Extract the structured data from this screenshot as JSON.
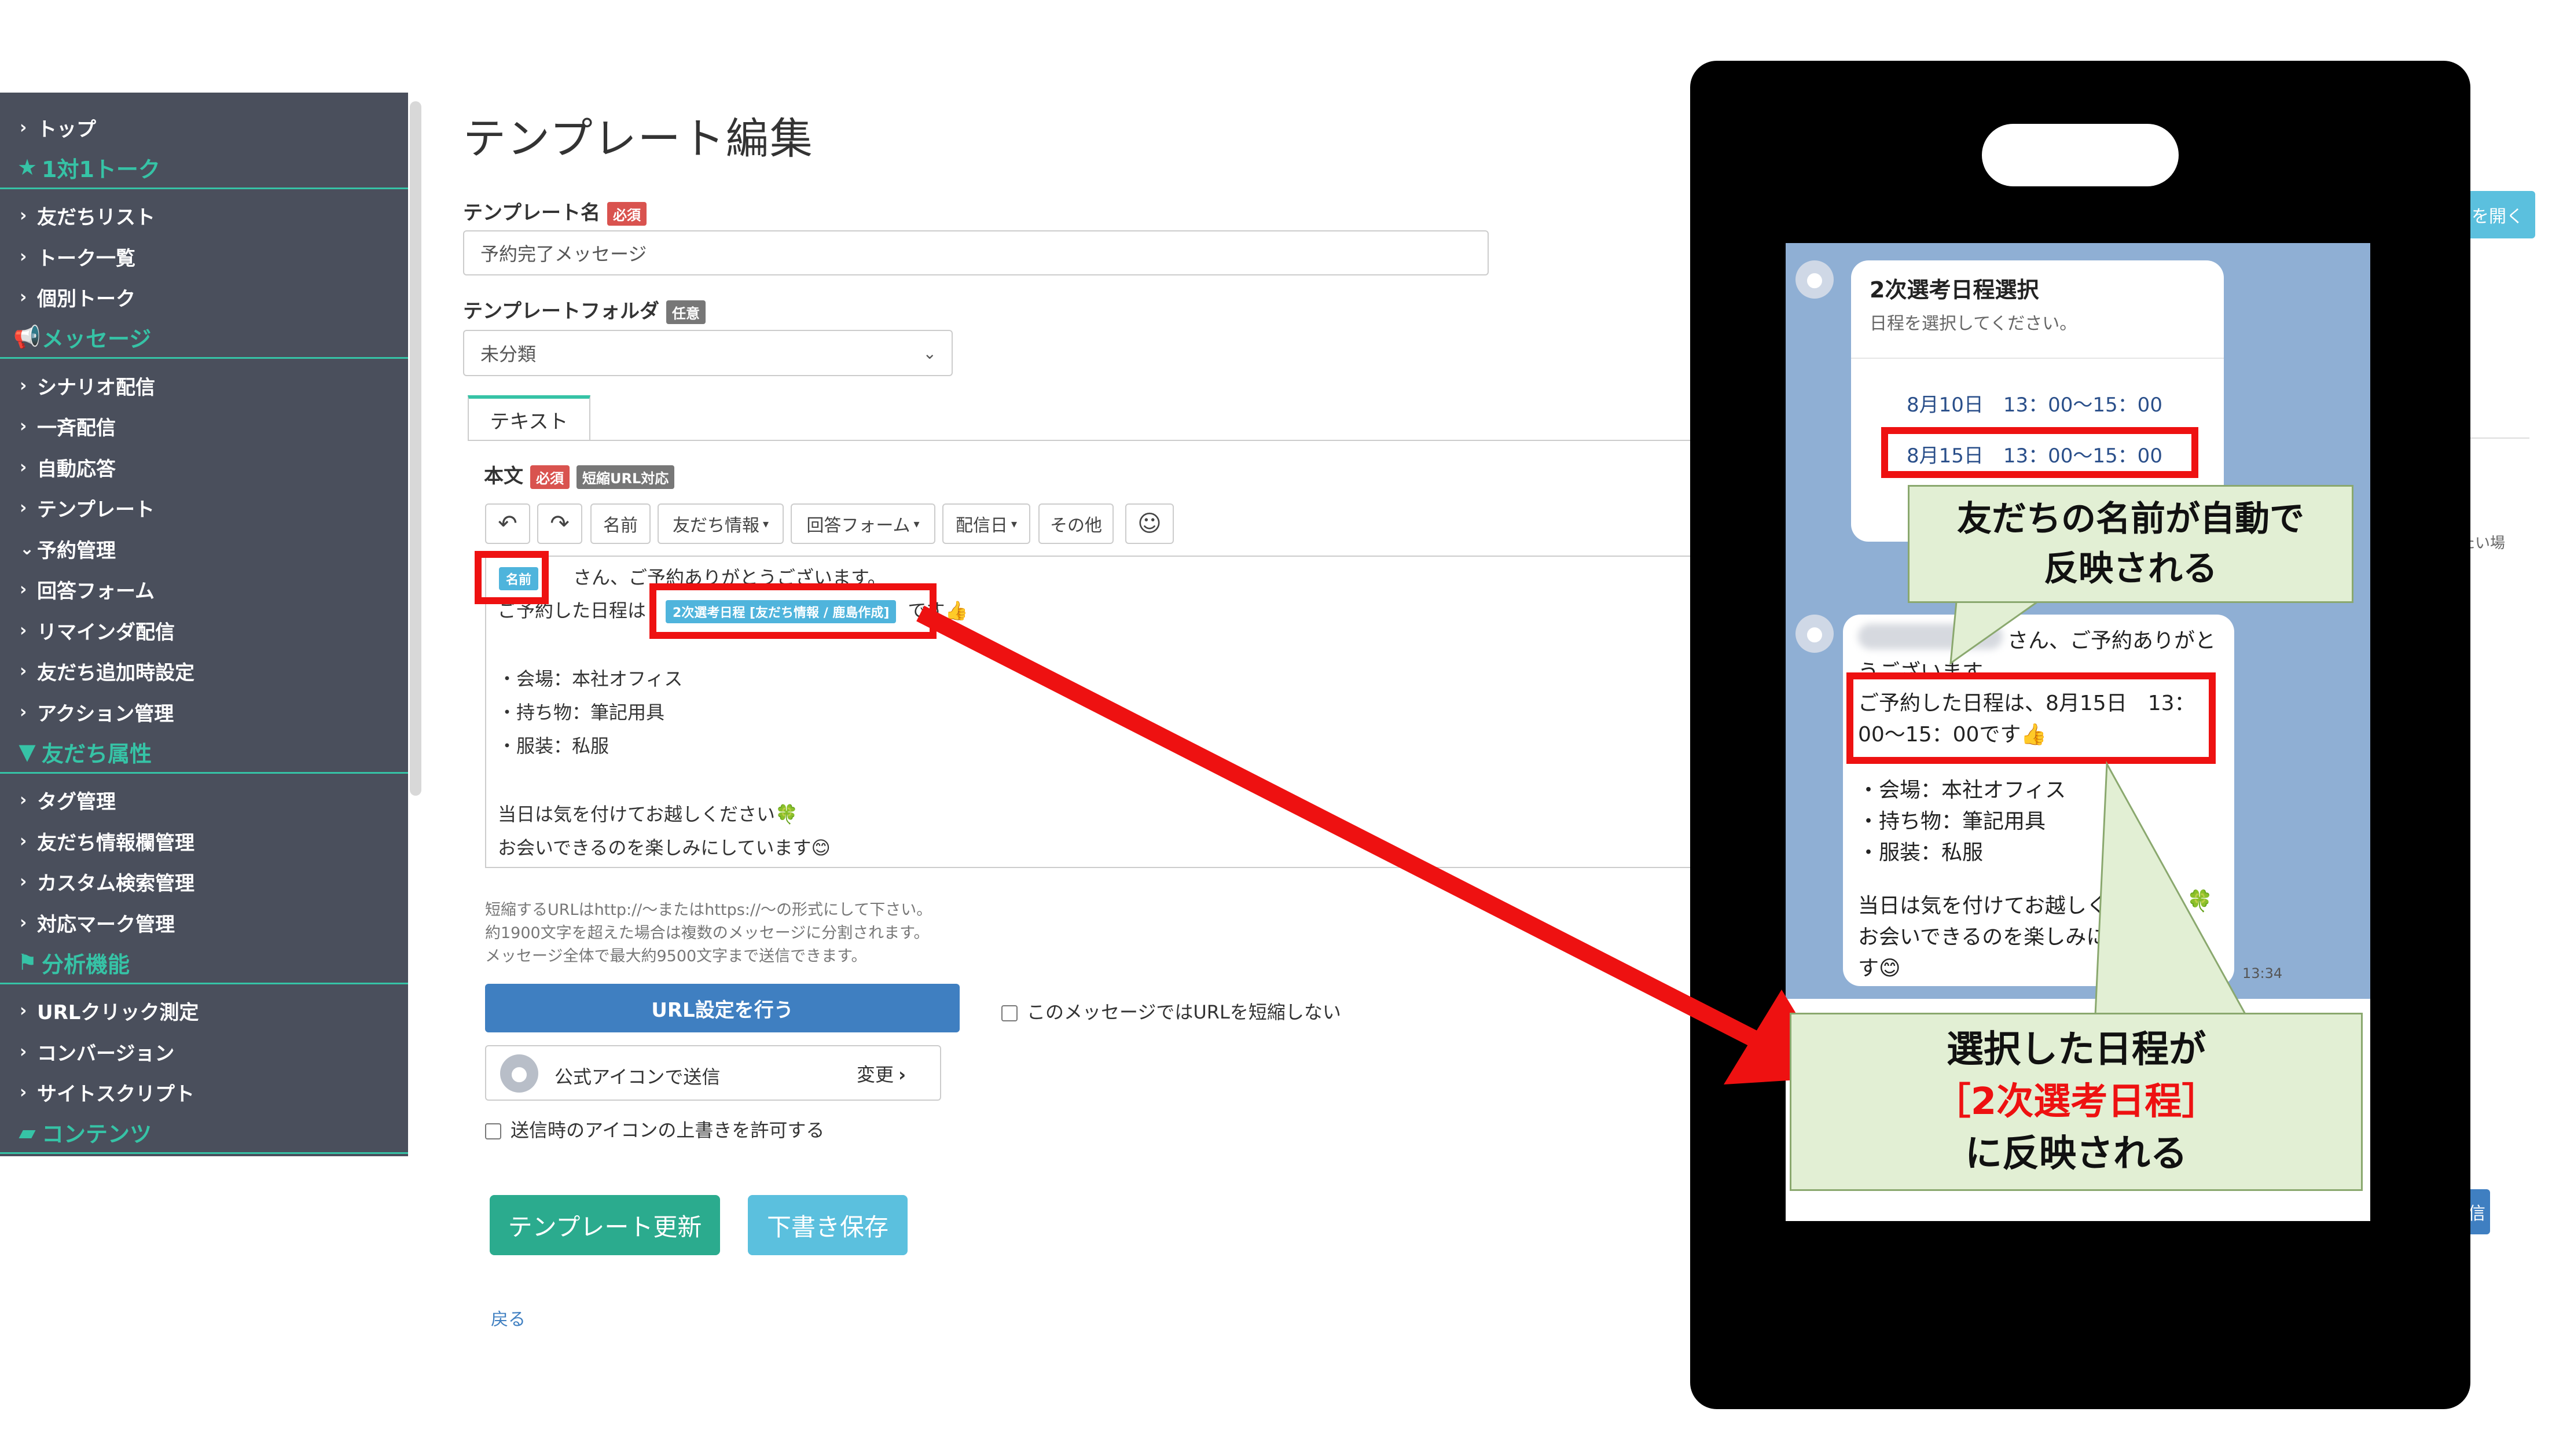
{
  "sidebar": {
    "items": [
      {
        "type": "item",
        "label": "トップ"
      },
      {
        "type": "head",
        "icon": "star-icon",
        "glyph": "★",
        "label": "1対1トーク"
      },
      {
        "type": "item",
        "label": "友だちリスト"
      },
      {
        "type": "item",
        "label": "トーク一覧"
      },
      {
        "type": "item",
        "label": "個別トーク"
      },
      {
        "type": "head",
        "icon": "megaphone-icon",
        "glyph": "📢",
        "label": "メッセージ"
      },
      {
        "type": "item",
        "label": "シナリオ配信"
      },
      {
        "type": "item",
        "label": "一斉配信"
      },
      {
        "type": "item",
        "label": "自動応答"
      },
      {
        "type": "item",
        "label": "テンプレート"
      },
      {
        "type": "item",
        "label": "予約管理",
        "open": true
      },
      {
        "type": "item",
        "label": "回答フォーム"
      },
      {
        "type": "item",
        "label": "リマインダ配信"
      },
      {
        "type": "item",
        "label": "友だち追加時設定"
      },
      {
        "type": "item",
        "label": "アクション管理"
      },
      {
        "type": "head",
        "icon": "filter-icon",
        "glyph": "▼",
        "label": "友だち属性"
      },
      {
        "type": "item",
        "label": "タグ管理"
      },
      {
        "type": "item",
        "label": "友だち情報欄管理"
      },
      {
        "type": "item",
        "label": "カスタム検索管理"
      },
      {
        "type": "item",
        "label": "対応マーク管理"
      },
      {
        "type": "head",
        "icon": "flag-icon",
        "glyph": "⚑",
        "label": "分析機能"
      },
      {
        "type": "item",
        "label": "URLクリック測定"
      },
      {
        "type": "item",
        "label": "コンバージョン"
      },
      {
        "type": "item",
        "label": "サイトスクリプト"
      },
      {
        "type": "head",
        "icon": "folder-icon",
        "glyph": "▰",
        "label": "コンテンツ"
      }
    ]
  },
  "main": {
    "title": "テンプレート編集",
    "name_label": "テンプレート名",
    "required_badge": "必須",
    "optional_badge": "任意",
    "name_value": "予約完了メッセージ",
    "folder_label": "テンプレートフォルダ",
    "folder_value": "未分類",
    "tab_text": "テキスト",
    "body_label": "本文",
    "short_url_badge": "短縮URL対応",
    "toolbar": {
      "undo": "↶",
      "redo": "↷",
      "name": "名前",
      "friend_info": "友だち情報",
      "answer_form": "回答フォーム",
      "delivery_date": "配信日",
      "other": "その他",
      "emoji": "☺"
    },
    "editor": {
      "name_chip": "名前",
      "line1_rest": "さん、ご予約ありがとうございます。",
      "line2_pre": "ご予約した日程は",
      "schedule_chip": "2次選考日程 [友だち情報 / 鹿島作成]",
      "line2_post": "です👍",
      "line3": "・会場：本社オフィス",
      "line4": "・持ち物：筆記用具",
      "line5": "・服装：私服",
      "line6": "当日は気を付けてお越しください🍀",
      "line7": "お会いできるのを楽しみにしています😊"
    },
    "notes": [
      "短縮するURLはhttp://〜またはhttps://〜の形式にして下さい。",
      "約1900文字を超えた場合は複数のメッセージに分割されます。",
      "メッセージ全体で最大約9500文字まで送信できます。"
    ],
    "url_button": "URL設定を行う",
    "no_shorten_label": "このメッセージではURLを短縮しない",
    "icon_send_label": "公式アイコンで送信",
    "change_label": "変更",
    "allow_icon_label": "送信時のアイコンの上書きを許可する",
    "update_button": "テンプレート更新",
    "draft_button": "下書き保存",
    "back_link": "戻る"
  },
  "right_fragments": {
    "open_button": "を開く",
    "side_text": "たい場",
    "bottom_button": "信"
  },
  "phone": {
    "card_title": "2次選考日程選択",
    "card_sub": "日程を選択してください。",
    "option1": "8月10日　13：00〜15：00",
    "option2": "8月15日　13：00〜15：00",
    "msg_name_suffix": "さん、ご予約ありがと",
    "msg_line1b": "うございます。",
    "msg_line2a": "ご予約した日程は、8月15日　13：",
    "msg_line2b": "00〜15：00です👍",
    "msg_line3": "・会場：本社オフィス",
    "msg_line4": "・持ち物：筆記用具",
    "msg_line5": "・服装：私服",
    "msg_line6": "当日は気を付けてお越しく",
    "msg_line7": "お会いできるのを楽しみに",
    "msg_line8": "す😊",
    "clover": "🍀",
    "time": "13:34"
  },
  "callouts": {
    "top_line1": "友だちの名前が自動で",
    "top_line2": "反映される",
    "bottom_line1": "選択した日程が",
    "bottom_line2": "［2次選考日程］",
    "bottom_line3": "に反映される"
  },
  "colors": {
    "sidebar_bg": "#4a4f5c",
    "accent_green": "#36c3a6",
    "highlight_red": "#ee1111",
    "primary_blue": "#3f7fc1",
    "update_green": "#2bab8e",
    "draft_cyan": "#5bc0de",
    "callout_bg": "#e2efd4"
  }
}
